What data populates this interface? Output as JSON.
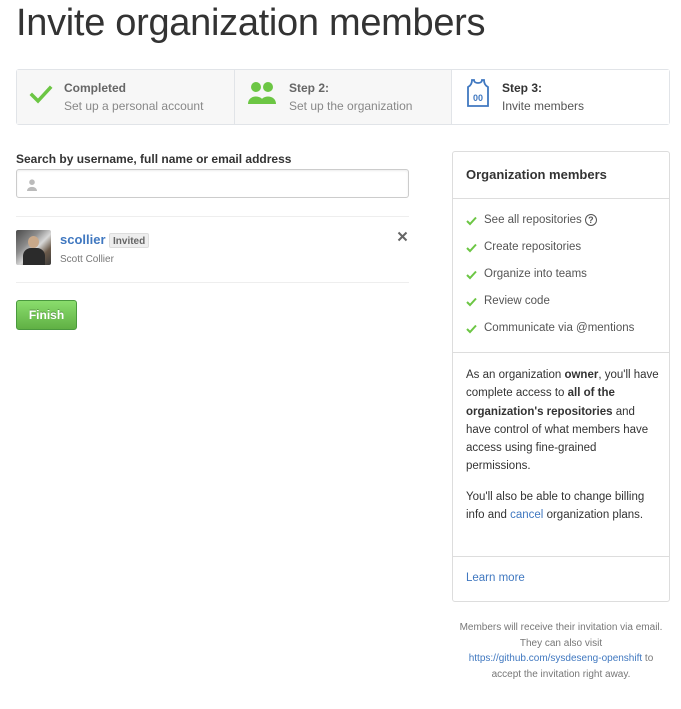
{
  "page": {
    "title": "Invite organization members"
  },
  "steps": [
    {
      "title": "Completed",
      "subtitle": "Set up a personal account",
      "icon": "checkmark-icon",
      "state": "completed"
    },
    {
      "title": "Step 2:",
      "subtitle": "Set up the organization",
      "icon": "people-icon",
      "state": "completed"
    },
    {
      "title": "Step 3:",
      "subtitle": "Invite members",
      "icon": "jersey-icon",
      "state": "current"
    }
  ],
  "search": {
    "label": "Search by username, full name or email address",
    "value": "",
    "placeholder": ""
  },
  "members": [
    {
      "login": "scollier",
      "badge": "Invited",
      "name": "Scott Collier"
    }
  ],
  "actions": {
    "finish_label": "Finish"
  },
  "sidebar": {
    "title": "Organization members",
    "permissions": [
      "See all repositories",
      "Create repositories",
      "Organize into teams",
      "Review code",
      "Communicate via @mentions"
    ],
    "help_glyph": "?",
    "owner_text": {
      "p1": "As an organization ",
      "owner": "owner",
      "p2": ", you'll have complete access to ",
      "access": "all of the organization's repositories",
      "p3": " and have control of what members have access using fine-grained permissions."
    },
    "billing_text": {
      "p1": "You'll also be able to change billing info and ",
      "cancel_link": "cancel",
      "p2": " organization plans."
    },
    "learn_more": "Learn more"
  },
  "footer_note": {
    "line1": "Members will receive their invitation via email.",
    "line2": "They can also visit",
    "url": "https://github.com/sysdeseng-openshift",
    "to": " to",
    "line3": "accept the invitation right away."
  },
  "colors": {
    "accent": "#4078c0",
    "success": "#6cc644",
    "button": "#60b044",
    "border": "#dddddd"
  }
}
